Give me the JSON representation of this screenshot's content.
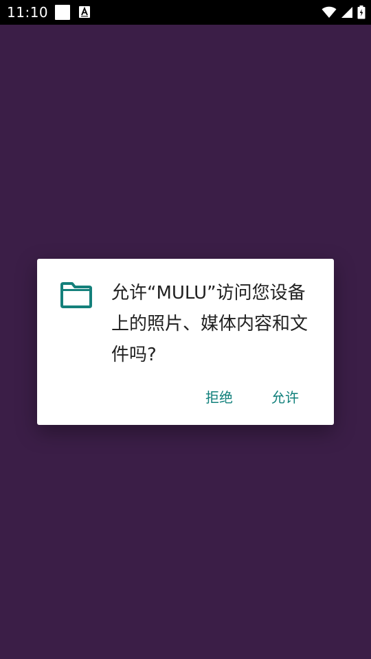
{
  "status_bar": {
    "time": "11:10",
    "icons": [
      "notification-square-icon",
      "accessibility-a-icon",
      "wifi-icon",
      "signal-icon",
      "battery-icon"
    ]
  },
  "dialog": {
    "icon": "folder-icon",
    "message": "允许“MULU”访问您设备上的照片、媒体内容和文件吗?",
    "deny_label": "拒绝",
    "allow_label": "允许"
  },
  "colors": {
    "background": "#3b1e47",
    "accent": "#0f7f7a",
    "icon": "#14807b",
    "text": "#212121"
  }
}
